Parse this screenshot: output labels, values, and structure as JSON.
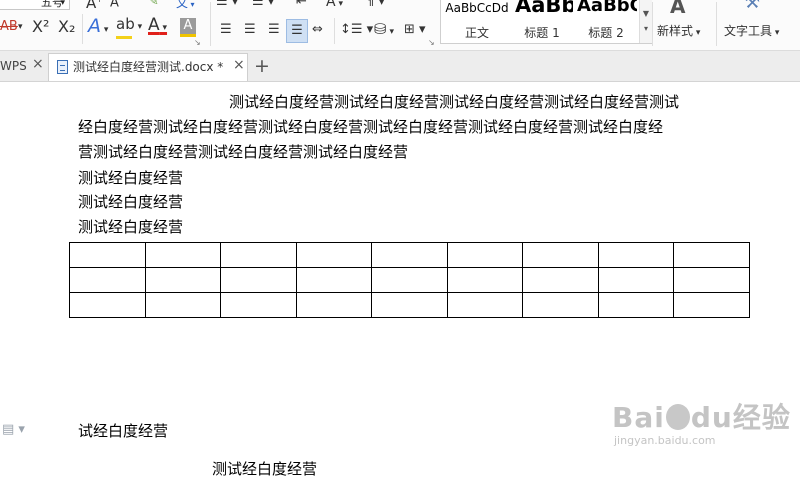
{
  "ribbon": {
    "font_size_value": "五号",
    "strikethrough_label": "AB",
    "superscript_label": "X²",
    "subscript_label": "X₂",
    "text_effect_label": "A",
    "highlight_label": "ab",
    "font_color_label": "A",
    "char_shading_label": "A",
    "increase_font_label": "A",
    "phonetic_label": "文",
    "styles": [
      {
        "preview": "AaBbCcDd",
        "label": "正文"
      },
      {
        "preview": "AaBb",
        "label": "标题 1"
      },
      {
        "preview": "AaBbC",
        "label": "标题 2"
      }
    ],
    "new_style_icon_label": "A",
    "new_style_label": "新样式",
    "text_tools_label": "文字工具",
    "colors": {
      "font_color_bar": "#e0201a",
      "highlight_bar": "#f3d11a",
      "shading_bar": "#f0c400"
    }
  },
  "tabs": {
    "wps_label": "WPS",
    "close_glyph": "×",
    "document_title": "测试经白度经营测试.docx *",
    "new_tab_glyph": "+"
  },
  "document": {
    "paragraph_lines": [
      "测试经白度经营测试经白度经营测试经白度经营测试经白度经营测试",
      "经白度经营测试经白度经营测试经白度经营测试经白度经营测试经白度经营测试经白度经",
      "营测试经白度经营测试经白度经营测试经白度经营"
    ],
    "lines": [
      "测试经白度经营",
      "测试经白度经营",
      "测试经白度经营"
    ],
    "table": {
      "rows": 3,
      "cols": 9
    },
    "bottom_line": "试经白度经营",
    "partial_line": "测试经白度经营"
  },
  "watermark": {
    "brand": "Bai",
    "brand_suffix": "du",
    "brand_cn": "经验",
    "url": "jingyan.baidu.com"
  }
}
